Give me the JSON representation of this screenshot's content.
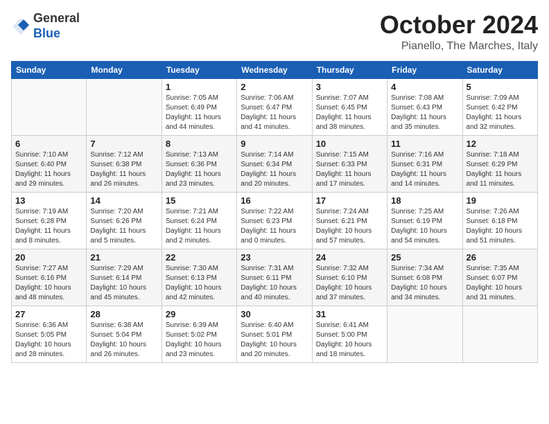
{
  "logo": {
    "line1": "General",
    "line2": "Blue"
  },
  "title": "October 2024",
  "location": "Pianello, The Marches, Italy",
  "weekdays": [
    "Sunday",
    "Monday",
    "Tuesday",
    "Wednesday",
    "Thursday",
    "Friday",
    "Saturday"
  ],
  "weeks": [
    [
      {
        "day": "",
        "info": ""
      },
      {
        "day": "",
        "info": ""
      },
      {
        "day": "1",
        "info": "Sunrise: 7:05 AM\nSunset: 6:49 PM\nDaylight: 11 hours and 44 minutes."
      },
      {
        "day": "2",
        "info": "Sunrise: 7:06 AM\nSunset: 6:47 PM\nDaylight: 11 hours and 41 minutes."
      },
      {
        "day": "3",
        "info": "Sunrise: 7:07 AM\nSunset: 6:45 PM\nDaylight: 11 hours and 38 minutes."
      },
      {
        "day": "4",
        "info": "Sunrise: 7:08 AM\nSunset: 6:43 PM\nDaylight: 11 hours and 35 minutes."
      },
      {
        "day": "5",
        "info": "Sunrise: 7:09 AM\nSunset: 6:42 PM\nDaylight: 11 hours and 32 minutes."
      }
    ],
    [
      {
        "day": "6",
        "info": "Sunrise: 7:10 AM\nSunset: 6:40 PM\nDaylight: 11 hours and 29 minutes."
      },
      {
        "day": "7",
        "info": "Sunrise: 7:12 AM\nSunset: 6:38 PM\nDaylight: 11 hours and 26 minutes."
      },
      {
        "day": "8",
        "info": "Sunrise: 7:13 AM\nSunset: 6:36 PM\nDaylight: 11 hours and 23 minutes."
      },
      {
        "day": "9",
        "info": "Sunrise: 7:14 AM\nSunset: 6:34 PM\nDaylight: 11 hours and 20 minutes."
      },
      {
        "day": "10",
        "info": "Sunrise: 7:15 AM\nSunset: 6:33 PM\nDaylight: 11 hours and 17 minutes."
      },
      {
        "day": "11",
        "info": "Sunrise: 7:16 AM\nSunset: 6:31 PM\nDaylight: 11 hours and 14 minutes."
      },
      {
        "day": "12",
        "info": "Sunrise: 7:18 AM\nSunset: 6:29 PM\nDaylight: 11 hours and 11 minutes."
      }
    ],
    [
      {
        "day": "13",
        "info": "Sunrise: 7:19 AM\nSunset: 6:28 PM\nDaylight: 11 hours and 8 minutes."
      },
      {
        "day": "14",
        "info": "Sunrise: 7:20 AM\nSunset: 6:26 PM\nDaylight: 11 hours and 5 minutes."
      },
      {
        "day": "15",
        "info": "Sunrise: 7:21 AM\nSunset: 6:24 PM\nDaylight: 11 hours and 2 minutes."
      },
      {
        "day": "16",
        "info": "Sunrise: 7:22 AM\nSunset: 6:23 PM\nDaylight: 11 hours and 0 minutes."
      },
      {
        "day": "17",
        "info": "Sunrise: 7:24 AM\nSunset: 6:21 PM\nDaylight: 10 hours and 57 minutes."
      },
      {
        "day": "18",
        "info": "Sunrise: 7:25 AM\nSunset: 6:19 PM\nDaylight: 10 hours and 54 minutes."
      },
      {
        "day": "19",
        "info": "Sunrise: 7:26 AM\nSunset: 6:18 PM\nDaylight: 10 hours and 51 minutes."
      }
    ],
    [
      {
        "day": "20",
        "info": "Sunrise: 7:27 AM\nSunset: 6:16 PM\nDaylight: 10 hours and 48 minutes."
      },
      {
        "day": "21",
        "info": "Sunrise: 7:29 AM\nSunset: 6:14 PM\nDaylight: 10 hours and 45 minutes."
      },
      {
        "day": "22",
        "info": "Sunrise: 7:30 AM\nSunset: 6:13 PM\nDaylight: 10 hours and 42 minutes."
      },
      {
        "day": "23",
        "info": "Sunrise: 7:31 AM\nSunset: 6:11 PM\nDaylight: 10 hours and 40 minutes."
      },
      {
        "day": "24",
        "info": "Sunrise: 7:32 AM\nSunset: 6:10 PM\nDaylight: 10 hours and 37 minutes."
      },
      {
        "day": "25",
        "info": "Sunrise: 7:34 AM\nSunset: 6:08 PM\nDaylight: 10 hours and 34 minutes."
      },
      {
        "day": "26",
        "info": "Sunrise: 7:35 AM\nSunset: 6:07 PM\nDaylight: 10 hours and 31 minutes."
      }
    ],
    [
      {
        "day": "27",
        "info": "Sunrise: 6:36 AM\nSunset: 5:05 PM\nDaylight: 10 hours and 28 minutes."
      },
      {
        "day": "28",
        "info": "Sunrise: 6:38 AM\nSunset: 5:04 PM\nDaylight: 10 hours and 26 minutes."
      },
      {
        "day": "29",
        "info": "Sunrise: 6:39 AM\nSunset: 5:02 PM\nDaylight: 10 hours and 23 minutes."
      },
      {
        "day": "30",
        "info": "Sunrise: 6:40 AM\nSunset: 5:01 PM\nDaylight: 10 hours and 20 minutes."
      },
      {
        "day": "31",
        "info": "Sunrise: 6:41 AM\nSunset: 5:00 PM\nDaylight: 10 hours and 18 minutes."
      },
      {
        "day": "",
        "info": ""
      },
      {
        "day": "",
        "info": ""
      }
    ]
  ]
}
